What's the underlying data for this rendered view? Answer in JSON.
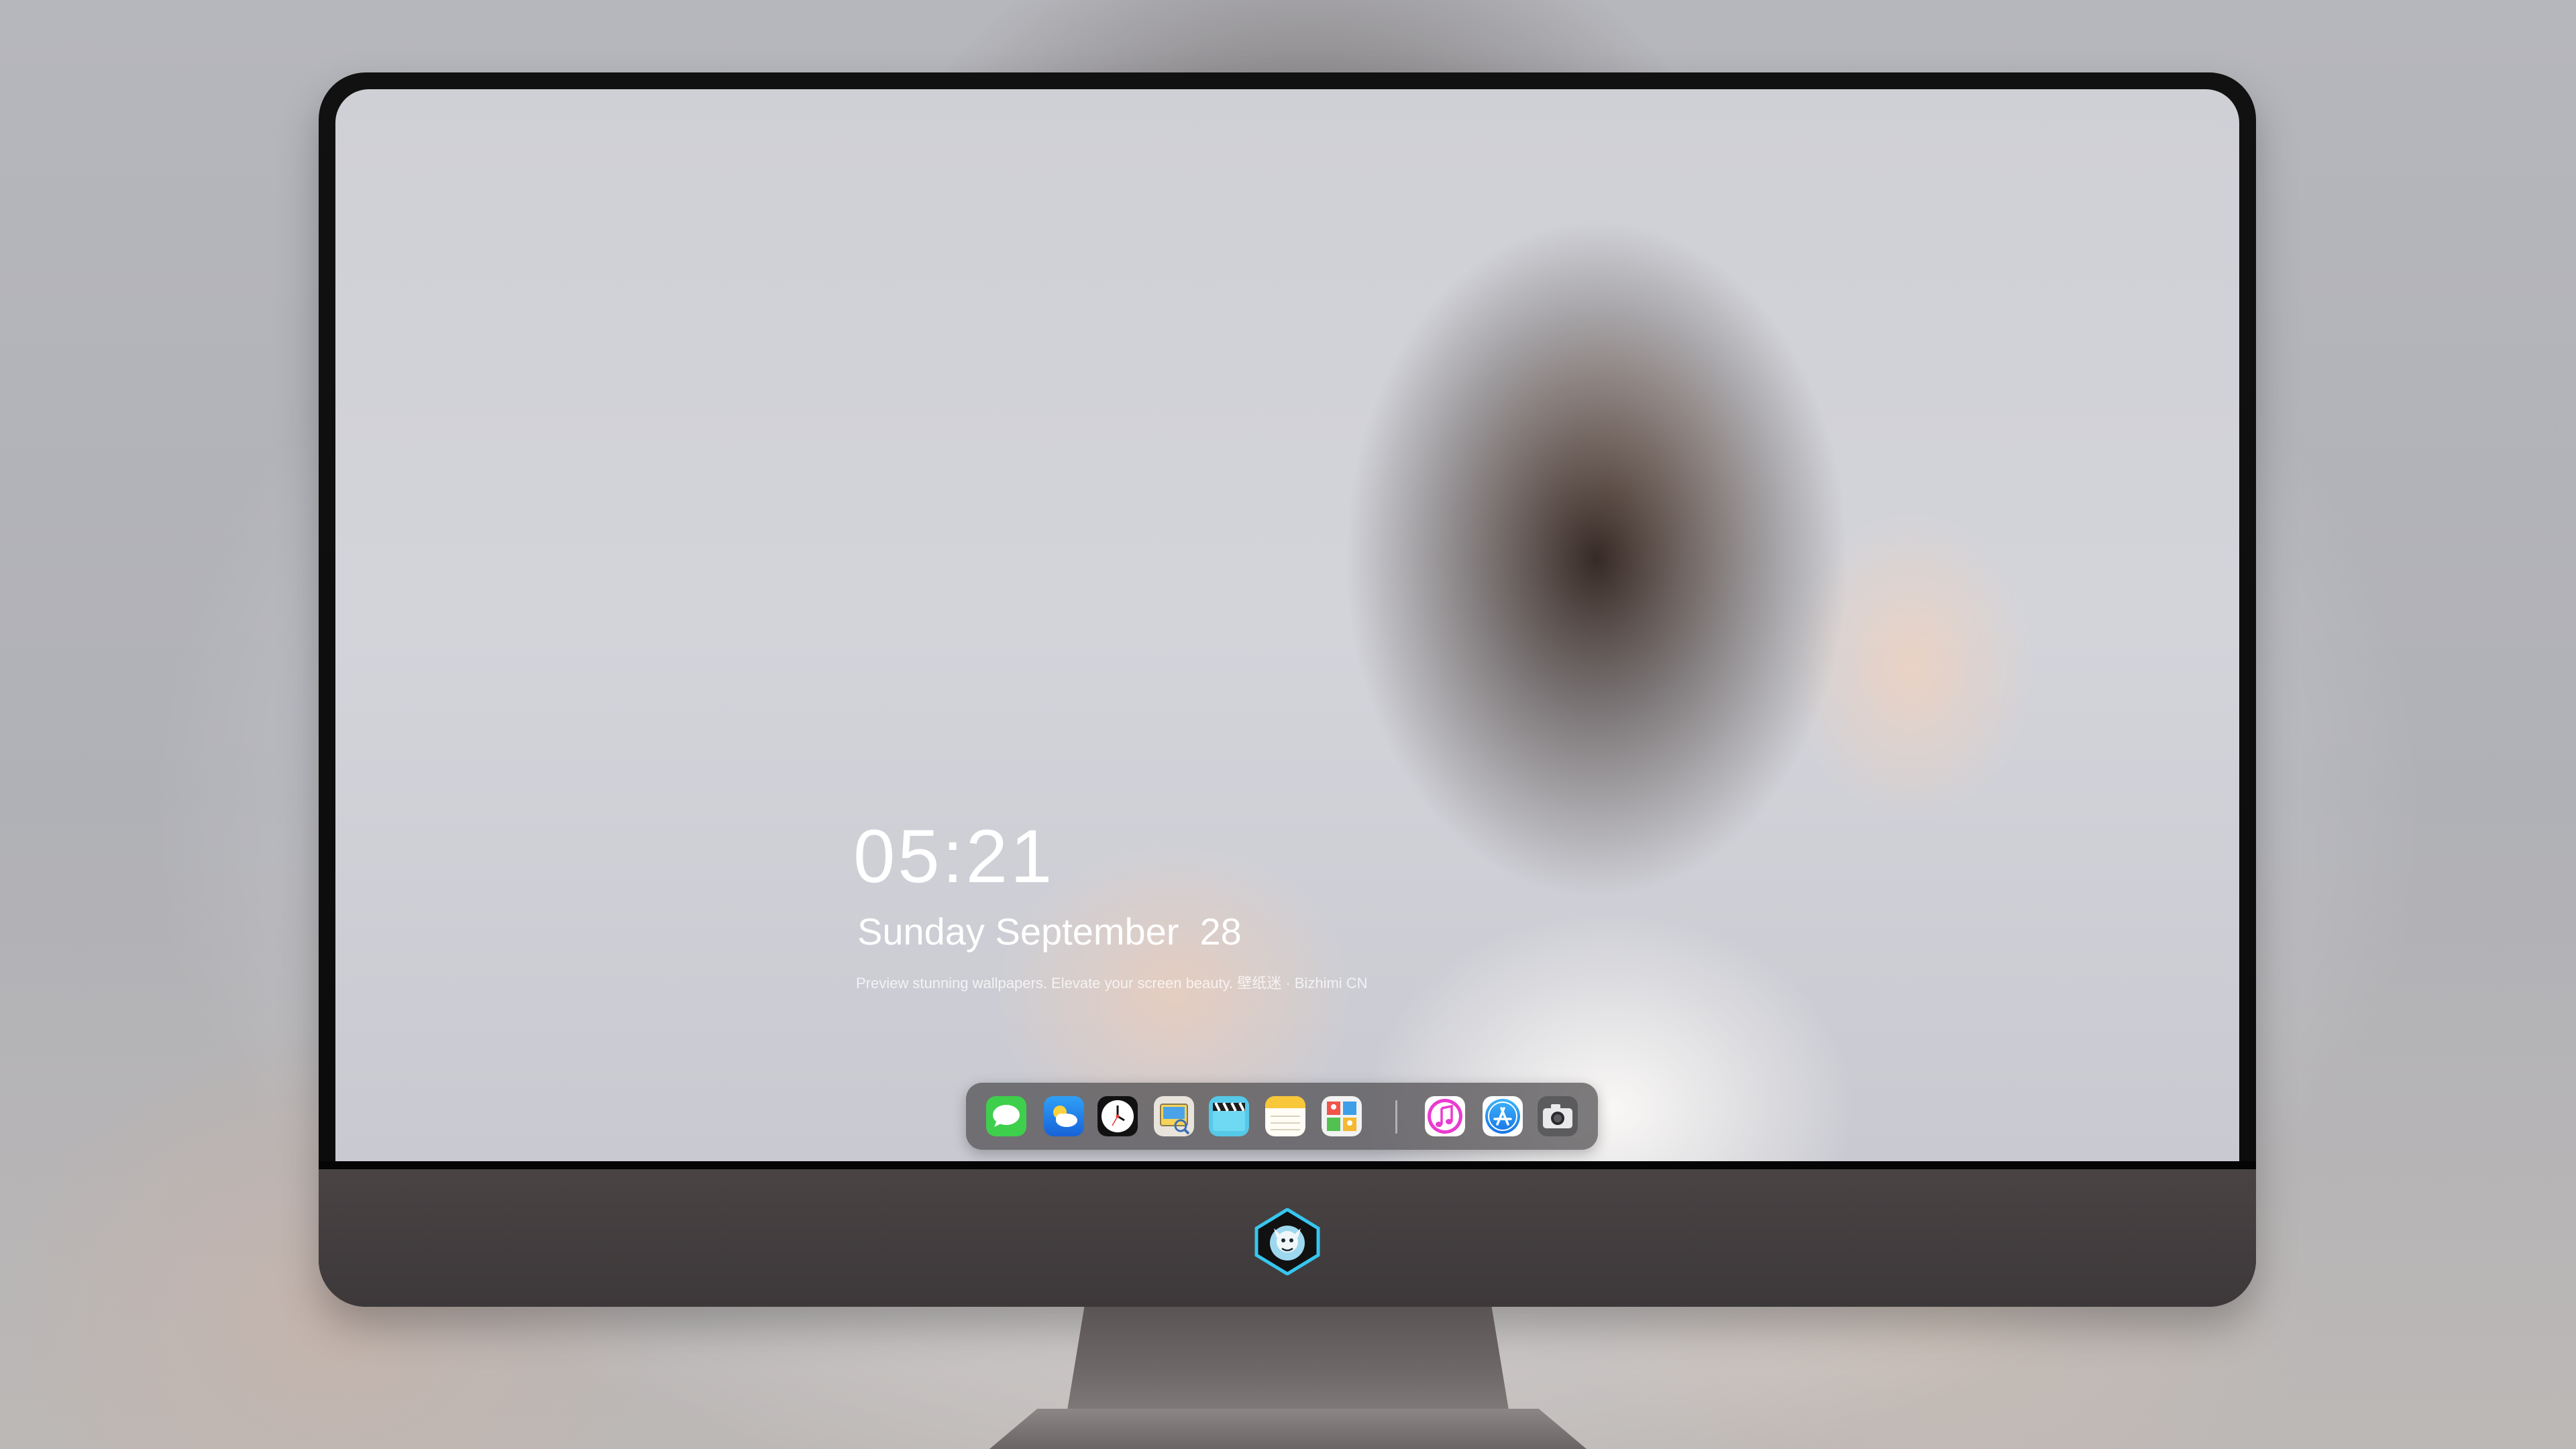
{
  "lockscreen": {
    "time": "05:21",
    "date": "Sunday September  28",
    "caption": "Preview stunning wallpapers. Elevate your screen beauty. 壁纸迷 · Bizhimi CN"
  },
  "dock": {
    "apps": [
      {
        "name": "messages",
        "icon": "messages-icon"
      },
      {
        "name": "weather",
        "icon": "weather-icon"
      },
      {
        "name": "clock",
        "icon": "clock-icon"
      },
      {
        "name": "preview",
        "icon": "preview-icon"
      },
      {
        "name": "video",
        "icon": "clapperboard-icon"
      },
      {
        "name": "notes",
        "icon": "notes-icon"
      },
      {
        "name": "photo-booth",
        "icon": "photo-booth-icon"
      },
      {
        "name": "music",
        "icon": "music-icon"
      },
      {
        "name": "app-store",
        "icon": "app-store-icon"
      },
      {
        "name": "camera",
        "icon": "camera-icon"
      }
    ]
  },
  "colors": {
    "accent_green": "#3ecf4c",
    "accent_blue": "#1f8cf5",
    "music_pink": "#e93bd0",
    "chin": "#433d3e",
    "bezel": "#0b0b0b"
  }
}
